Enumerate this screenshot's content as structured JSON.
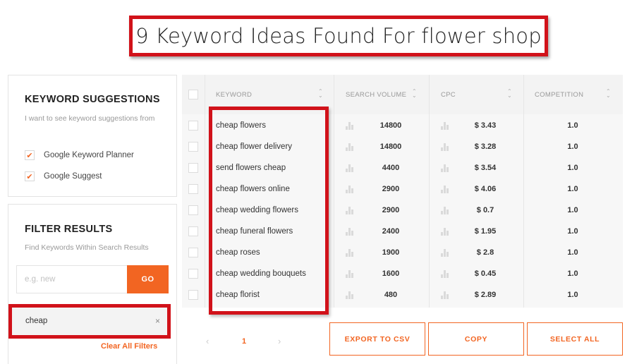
{
  "title": "9 Keyword Ideas Found For flower shop",
  "suggestions": {
    "heading": "KEYWORD SUGGESTIONS",
    "description": "I want to see keyword suggestions from",
    "sources": [
      {
        "label": "Google Keyword Planner",
        "checked": true
      },
      {
        "label": "Google Suggest",
        "checked": true
      }
    ]
  },
  "filter": {
    "heading": "FILTER RESULTS",
    "description": "Find Keywords Within Search Results",
    "placeholder": "e.g. new",
    "go_label": "GO",
    "active_filter": "cheap",
    "remove_icon": "×",
    "clear_label": "Clear All Filters"
  },
  "table": {
    "columns": [
      "KEYWORD",
      "SEARCH VOLUME",
      "CPC",
      "COMPETITION"
    ],
    "rows": [
      {
        "keyword": "cheap flowers",
        "volume": "14800",
        "cpc": "$ 3.43",
        "competition": "1.0"
      },
      {
        "keyword": "cheap flower delivery",
        "volume": "14800",
        "cpc": "$ 3.28",
        "competition": "1.0"
      },
      {
        "keyword": "send flowers cheap",
        "volume": "4400",
        "cpc": "$ 3.54",
        "competition": "1.0"
      },
      {
        "keyword": "cheap flowers online",
        "volume": "2900",
        "cpc": "$ 4.06",
        "competition": "1.0"
      },
      {
        "keyword": "cheap wedding flowers",
        "volume": "2900",
        "cpc": "$ 0.7",
        "competition": "1.0"
      },
      {
        "keyword": "cheap funeral flowers",
        "volume": "2400",
        "cpc": "$ 1.95",
        "competition": "1.0"
      },
      {
        "keyword": "cheap roses",
        "volume": "1900",
        "cpc": "$ 2.8",
        "competition": "1.0"
      },
      {
        "keyword": "cheap wedding bouquets",
        "volume": "1600",
        "cpc": "$ 0.45",
        "competition": "1.0"
      },
      {
        "keyword": "cheap florist",
        "volume": "480",
        "cpc": "$ 2.89",
        "competition": "1.0"
      }
    ]
  },
  "pagination": {
    "prev": "‹",
    "page": "1",
    "next": "›"
  },
  "actions": {
    "export": "EXPORT TO CSV",
    "copy": "COPY",
    "select_all": "SELECT ALL"
  },
  "colors": {
    "accent": "#f26522",
    "highlight": "#d1121a"
  }
}
